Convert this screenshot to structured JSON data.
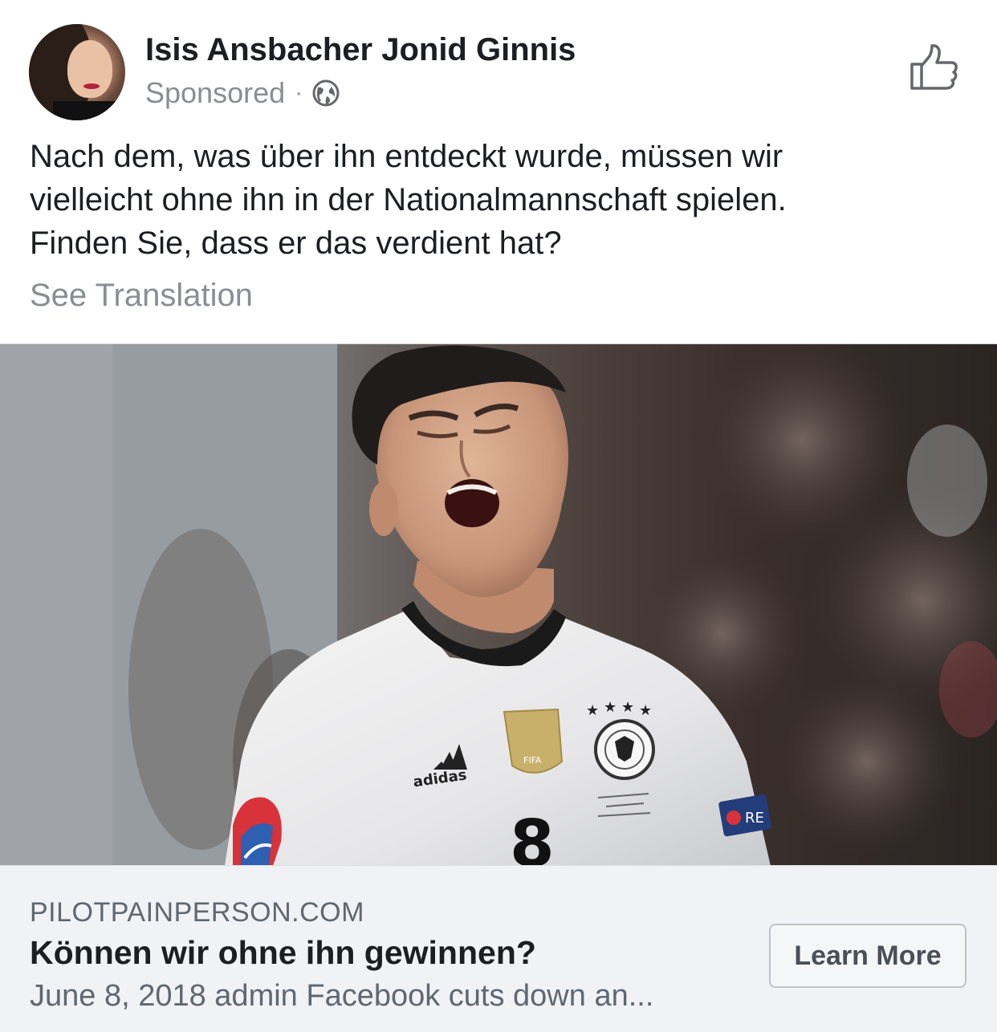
{
  "post": {
    "author": "Isis Ansbacher Jonid Ginnis",
    "sponsored_label": "Sponsored",
    "separator": "·",
    "privacy_icon": "globe-icon",
    "like_icon": "thumbs-up-icon",
    "text_lines": [
      "Nach dem, was über ihn entdeckt wurde, müssen wir",
      "vielleicht ohne ihn in der Nationalmannschaft spielen.",
      "Finden Sie, dass er das verdient hat?"
    ],
    "see_translation": "See Translation"
  },
  "link_preview": {
    "domain": "PILOTPAINPERSON.COM",
    "headline": "Können wir ohne ihn gewinnen?",
    "description": "June 8, 2018 admin Facebook cuts down an...",
    "cta_label": "Learn More"
  },
  "photo": {
    "jersey_brand": "adidas",
    "badge_text": "FIFA",
    "jersey_number": "8",
    "sleeve_patch_text": "RE"
  },
  "colors": {
    "text_primary": "#1c1e21",
    "text_secondary": "#8a8d91",
    "card_background": "#f0f2f5",
    "button_border": "#bec3c9"
  }
}
